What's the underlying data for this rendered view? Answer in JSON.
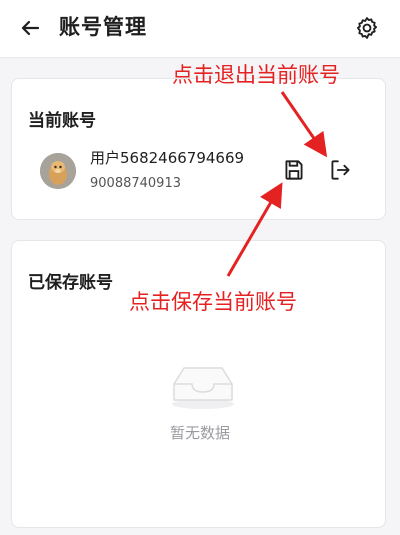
{
  "header": {
    "back_icon": "arrow-left-icon",
    "title": "账号管理",
    "settings_icon": "gear-icon"
  },
  "current_account": {
    "section_title": "当前账号",
    "avatar_icon": "avatar-image",
    "username": "用户5682466794669",
    "user_id": "90088740913",
    "save_icon": "floppy-disk-icon",
    "logout_icon": "logout-arrow-icon"
  },
  "saved_accounts": {
    "section_title": "已保存账号",
    "empty_icon": "empty-inbox-icon",
    "empty_text": "暂无数据"
  },
  "annotations": {
    "logout_hint": "点击退出当前账号",
    "save_hint": "点击保存当前账号",
    "color": "#e52222"
  }
}
